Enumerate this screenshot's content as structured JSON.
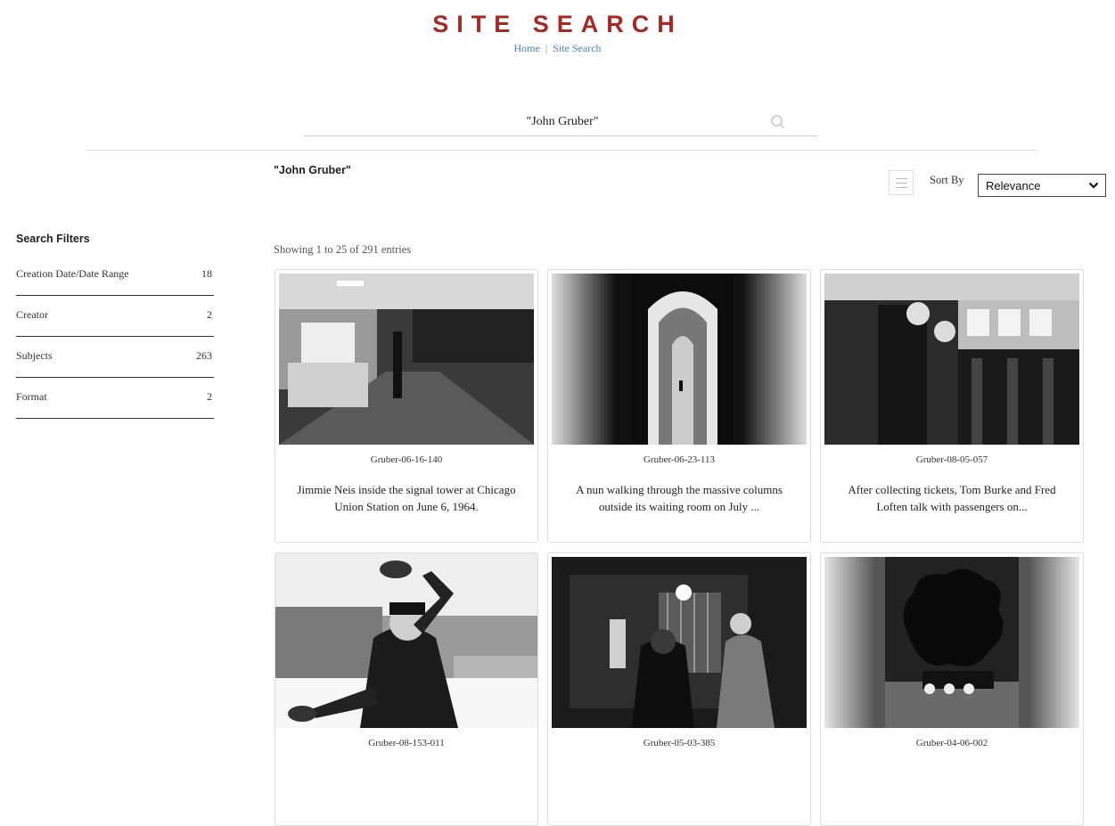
{
  "header": {
    "title": "SITE SEARCH",
    "breadcrumb": [
      {
        "label": "Home"
      },
      {
        "label": "Site Search"
      }
    ],
    "separator": "|"
  },
  "search": {
    "value": "\"John Gruber\"",
    "placeholder": ""
  },
  "results_header": {
    "query": "\"John Gruber\"",
    "sort_label": "Sort By",
    "sort_value": "Relevance",
    "showing": "Showing 1 to 25 of 291 entries"
  },
  "filters": {
    "title": "Search Filters",
    "items": [
      {
        "label": "Creation Date/Date Range",
        "count": "18"
      },
      {
        "label": "Creator",
        "count": "2"
      },
      {
        "label": "Subjects",
        "count": "263"
      },
      {
        "label": "Format",
        "count": "2"
      }
    ]
  },
  "results": [
    {
      "id": "Gruber-06-16-140",
      "desc": "Jimmie Neis inside the signal tower at Chicago Union Station on June 6, 1964."
    },
    {
      "id": "Gruber-06-23-113",
      "desc": "A nun walking through the massive columns outside its waiting room on July ..."
    },
    {
      "id": "Gruber-08-05-057",
      "desc": "After collecting tickets, Tom Burke and Fred Loften talk with passengers on..."
    },
    {
      "id": "Gruber-08-153-011",
      "desc": ""
    },
    {
      "id": "Gruber-05-03-385",
      "desc": ""
    },
    {
      "id": "Gruber-04-06-002",
      "desc": ""
    }
  ]
}
